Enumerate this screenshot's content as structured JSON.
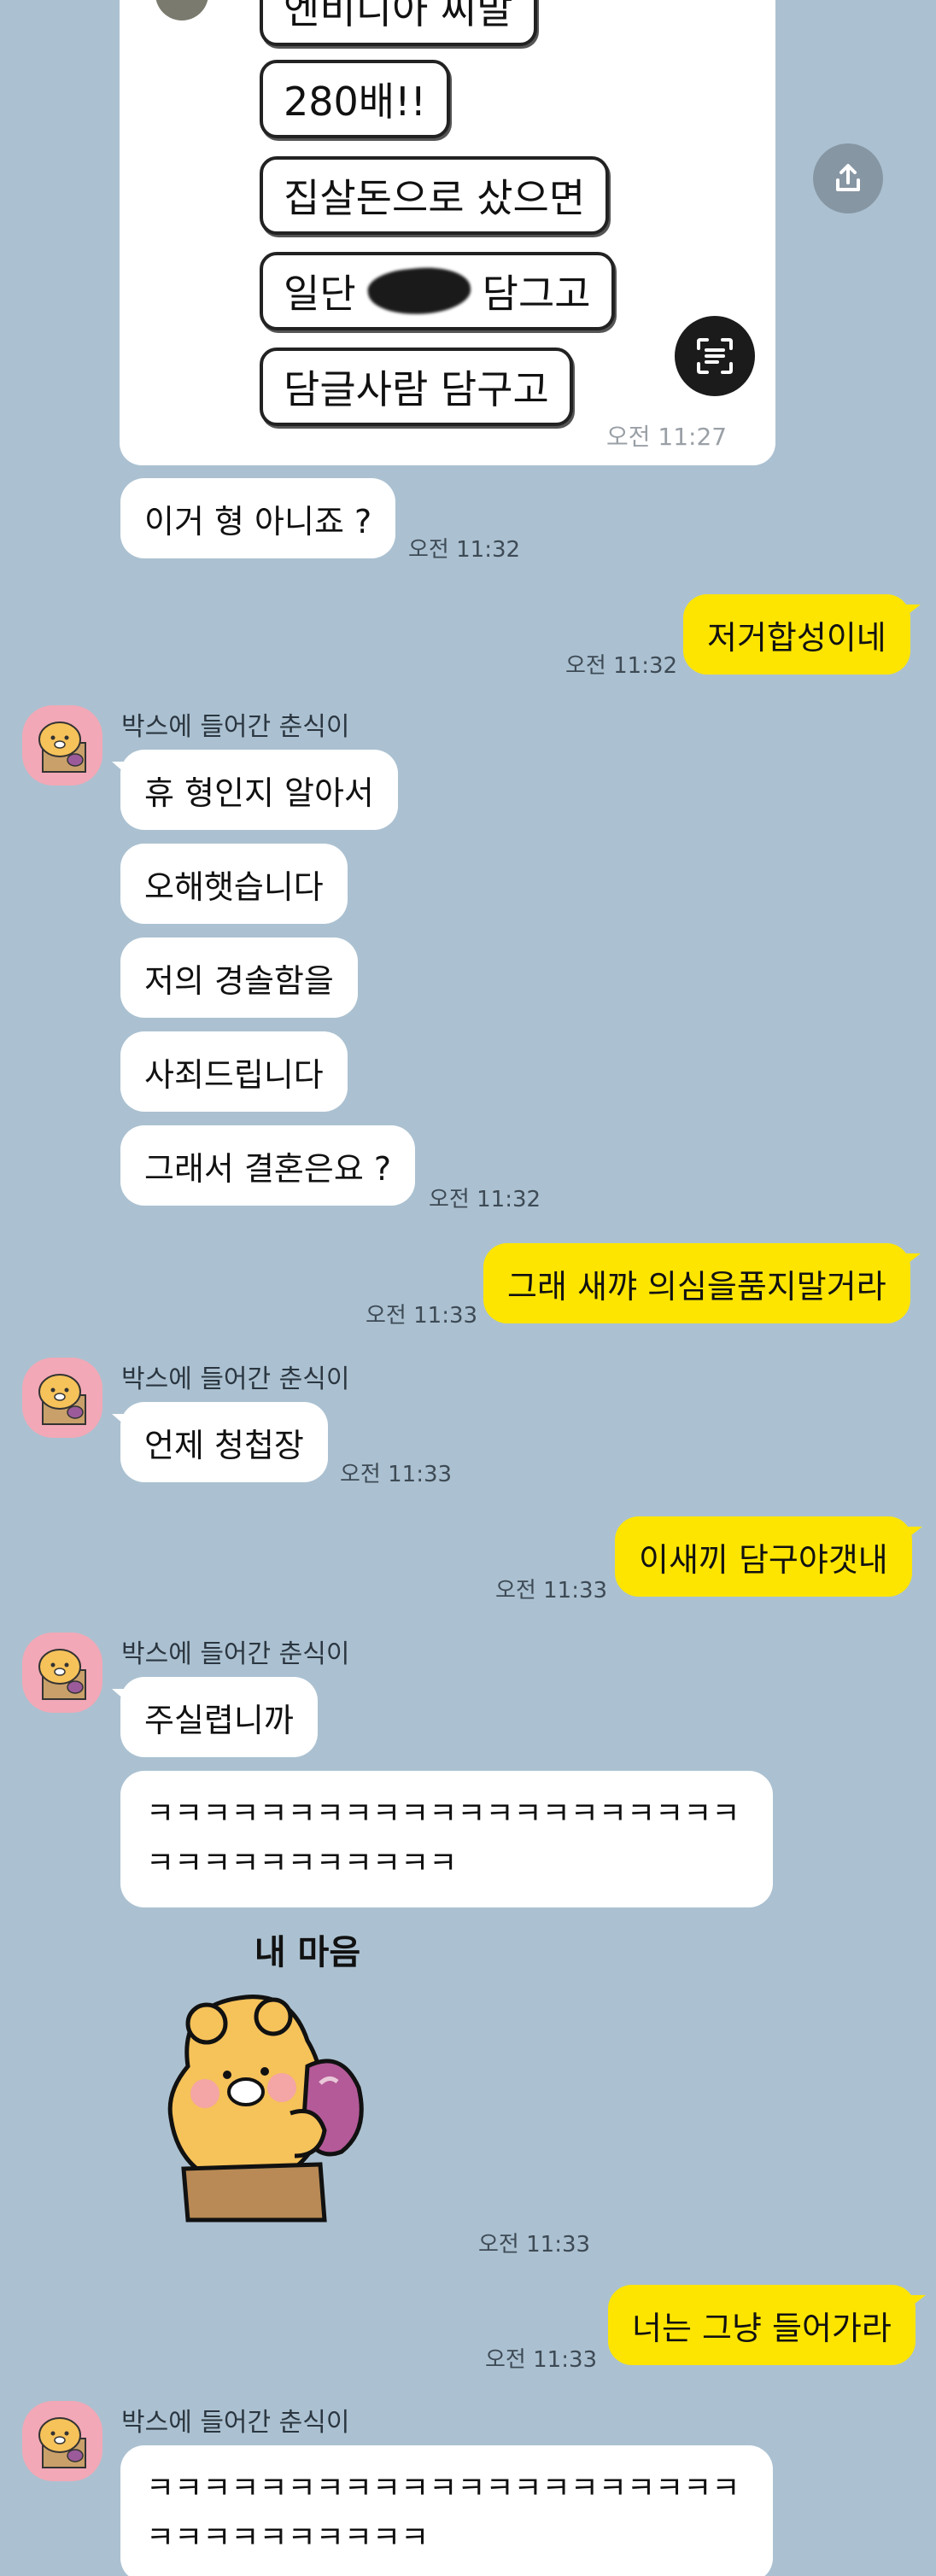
{
  "image_card": {
    "lines": [
      "엔비디아 씨발",
      "280배!!",
      "집살돈으로 샀으면",
      "일단",
      "담그고",
      "담글사람 담구고"
    ],
    "time": "오전 11:27"
  },
  "icons": {
    "share": "share-upload-icon",
    "ocr": "text-scan-icon",
    "avatar": "ryan-character-avatar"
  },
  "messages": {
    "m1": {
      "text": "이거 형 아니죠 ?",
      "time": "오전 11:32"
    },
    "m2": {
      "text": "저거합성이네",
      "time": "오전 11:32"
    },
    "group1": {
      "sender": "박스에 들어간 춘식이",
      "items": [
        "휴 형인지 알아서",
        "오해햇습니다",
        "저의 경솔함을",
        "사죄드립니다",
        "그래서 결혼은요 ?"
      ],
      "time": "오전 11:32"
    },
    "m3": {
      "text": "그래 새꺄 의심을품지말거라",
      "time": "오전 11:33"
    },
    "group2": {
      "sender": "박스에 들어간 춘식이",
      "text": "언제 청첩장",
      "time": "오전 11:33"
    },
    "m4": {
      "text": "이새끼 담구야갯내",
      "time": "오전 11:33"
    },
    "group3": {
      "sender": "박스에 들어간 춘식이",
      "text": "주실렵니까",
      "long": "ㅋㅋㅋㅋㅋㅋㅋㅋㅋㅋㅋㅋㅋㅋㅋㅋㅋㅋㅋㅋㅋㅋㅋㅋㅋㅋㅋㅋㅋㅋㅋㅋ",
      "sticker_caption": "내 마음",
      "time": "오전 11:33"
    },
    "m5": {
      "text": "너는 그냥 들어가라",
      "time": "오전 11:33"
    },
    "group4": {
      "sender": "박스에 들어간 춘식이",
      "long": "ㅋㅋㅋㅋㅋㅋㅋㅋㅋㅋㅋㅋㅋㅋㅋㅋㅋㅋㅋㅋㅋㅋㅋㅋㅋㅋㅋㅋㅋㅋㅋ"
    }
  },
  "colors": {
    "background": "#abc1d1",
    "outgoing": "#fee500",
    "incoming": "#ffffff"
  }
}
